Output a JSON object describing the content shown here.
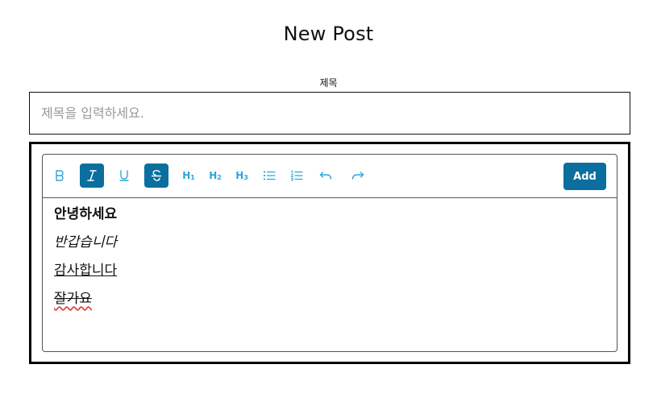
{
  "page": {
    "title": "New Post"
  },
  "title_field": {
    "label": "제목",
    "placeholder": "제목을 입력하세요.",
    "value": ""
  },
  "toolbar": {
    "buttons": [
      {
        "name": "bold",
        "icon": "bold-icon",
        "active": false
      },
      {
        "name": "italic",
        "icon": "italic-icon",
        "active": true
      },
      {
        "name": "underline",
        "icon": "underline-icon",
        "active": false
      },
      {
        "name": "strikethrough",
        "icon": "strikethrough-icon",
        "active": true
      },
      {
        "name": "heading-1",
        "label": "H1",
        "icon": "heading-1-icon",
        "active": false
      },
      {
        "name": "heading-2",
        "label": "H2",
        "icon": "heading-2-icon",
        "active": false
      },
      {
        "name": "heading-3",
        "label": "H3",
        "icon": "heading-3-icon",
        "active": false
      },
      {
        "name": "bullet-list",
        "icon": "bullet-list-icon",
        "active": false
      },
      {
        "name": "ordered-list",
        "icon": "ordered-list-icon",
        "active": false
      },
      {
        "name": "undo",
        "icon": "undo-icon",
        "active": false
      },
      {
        "name": "redo",
        "icon": "redo-icon",
        "active": false
      }
    ],
    "add_label": "Add",
    "colors": {
      "icon": "#2aa6d8",
      "active_bg": "#0a6e9e",
      "active_icon": "#ffffff"
    }
  },
  "content": {
    "lines": [
      {
        "text": "안녕하세요",
        "style": "bold"
      },
      {
        "text": "반갑습니다",
        "style": "italic"
      },
      {
        "text": "감사합니다",
        "style": "underline"
      },
      {
        "text": "잘가요",
        "style": "strikethrough"
      }
    ]
  }
}
